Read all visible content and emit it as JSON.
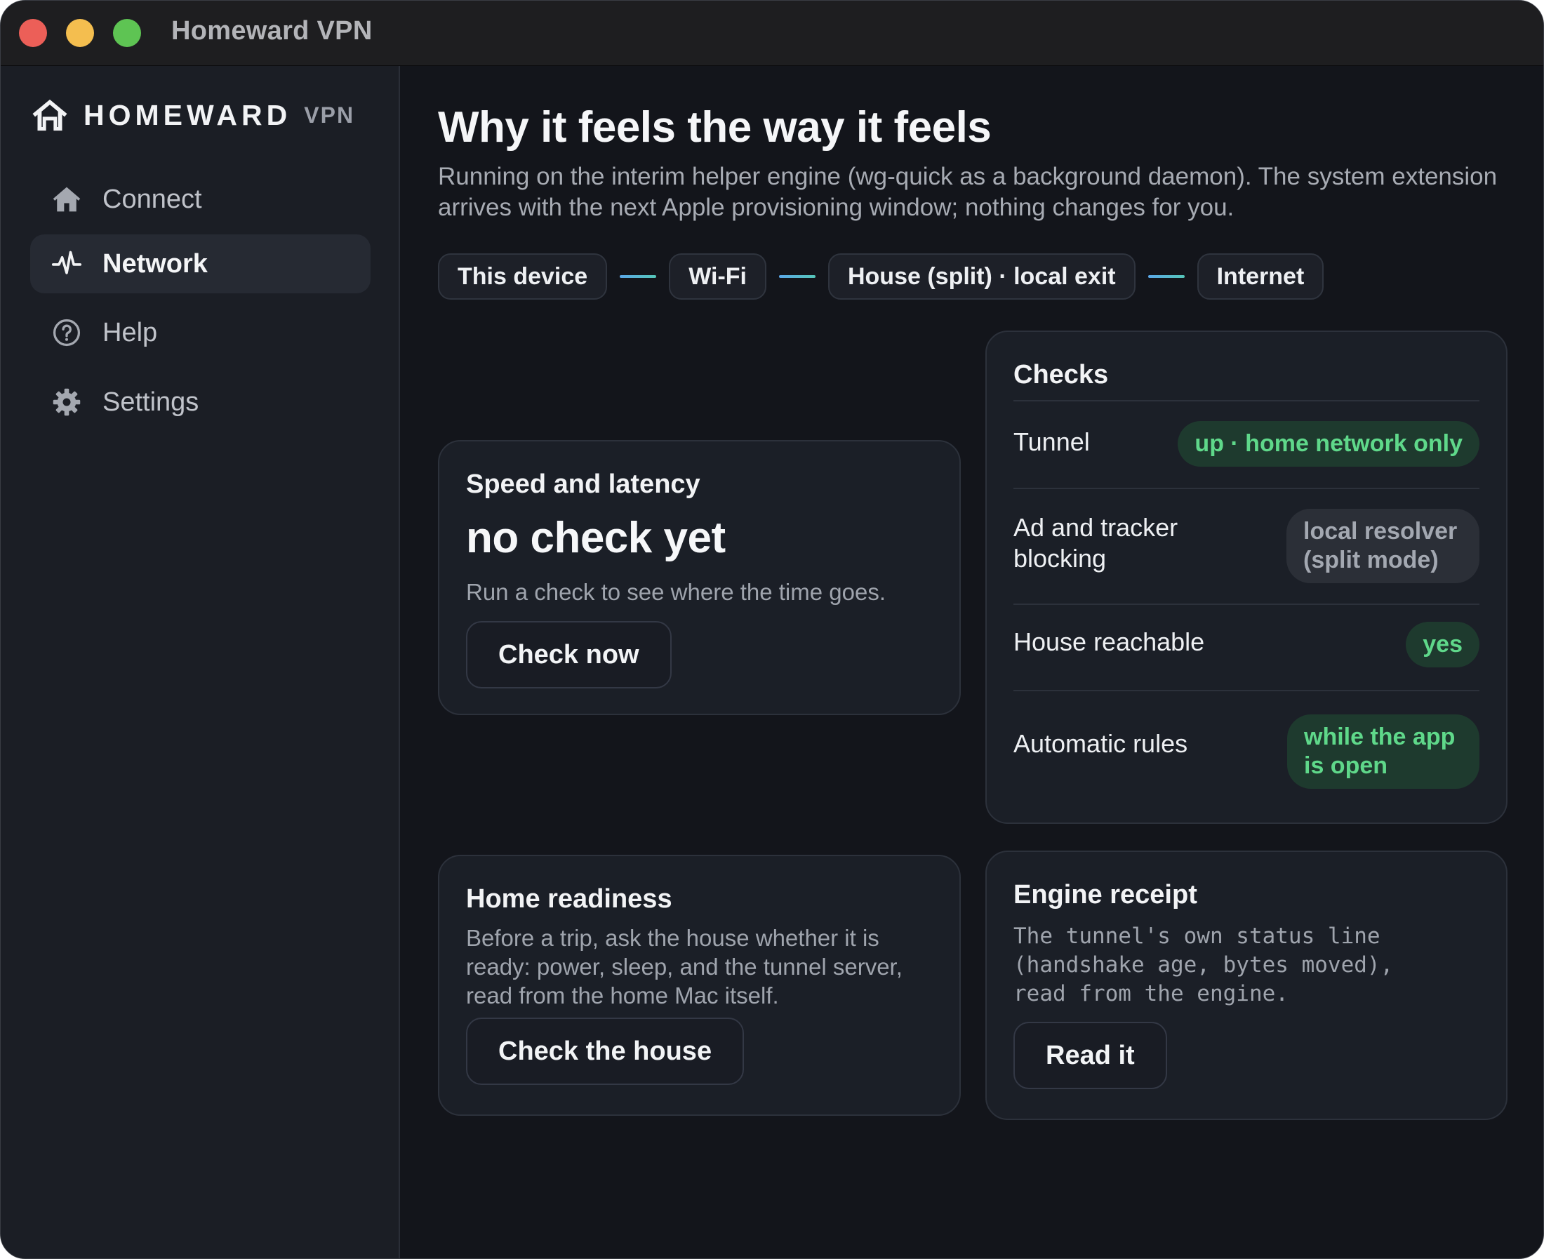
{
  "window": {
    "title": "Homeward VPN"
  },
  "sidebar": {
    "brand_name": "HOMEWARD",
    "brand_suffix": "VPN",
    "items": [
      {
        "label": "Connect",
        "icon": "house-icon",
        "active": false
      },
      {
        "label": "Network",
        "icon": "pulse-icon",
        "active": true
      },
      {
        "label": "Help",
        "icon": "question-circle-icon",
        "active": false
      },
      {
        "label": "Settings",
        "icon": "gear-icon",
        "active": false
      }
    ]
  },
  "main": {
    "title": "Why it feels the way it feels",
    "subtitle": "Running on the interim helper engine (wg-quick as a background daemon). The system extension arrives with the next Apple provisioning window; nothing changes for you.",
    "path": [
      "This device",
      "Wi-Fi",
      "House (split) · local exit",
      "Internet"
    ],
    "speed_card": {
      "title": "Speed and latency",
      "status": "no check yet",
      "description": "Run a check to see where the time goes.",
      "button": "Check now"
    },
    "checks_card": {
      "title": "Checks",
      "rows": [
        {
          "label": "Tunnel",
          "value": "up · home network only",
          "state": "ok"
        },
        {
          "label": "Ad and tracker blocking",
          "value": "local resolver (split mode)",
          "state": "neutral"
        },
        {
          "label": "House reachable",
          "value": "yes",
          "state": "ok"
        },
        {
          "label": "Automatic rules",
          "value": "while the app is open",
          "state": "ok"
        }
      ]
    },
    "home_card": {
      "title": "Home readiness",
      "description": "Before a trip, ask the house whether it is ready: power, sleep, and the tunnel server, read from the home Mac itself.",
      "button": "Check the house"
    },
    "engine_card": {
      "title": "Engine receipt",
      "description": "The tunnel's own status line\n(handshake age, bytes moved),\nread from the engine.",
      "button": "Read it"
    }
  },
  "colors": {
    "background": "#13151b",
    "sidebar": "#1b1e25",
    "card": "#1b1f27",
    "accent_ok": "#5fd88a",
    "connector": "#5aa7e8"
  }
}
